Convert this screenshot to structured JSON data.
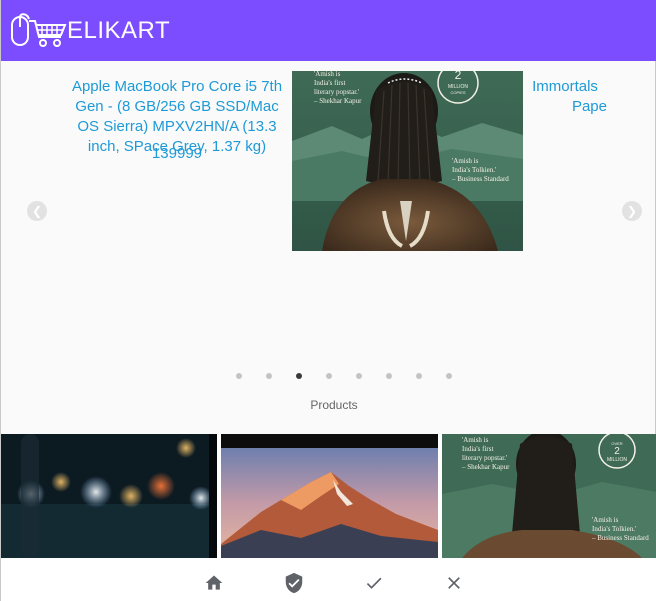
{
  "app": {
    "brand": "ELIKART",
    "accent": "#7c4dff",
    "link_color": "#1e9ad6"
  },
  "carousel": {
    "current_item": {
      "title": "Apple MacBook Pro Core i5 7th Gen - (8 GB/256 GB SSD/Mac OS Sierra) MPXV2HN/A  (13.3 inch, SPace Grey, 1.37 kg)",
      "price": "139999"
    },
    "next_item": {
      "title_line1": "Immortals",
      "title_line2": "Pape"
    },
    "book_cover": {
      "quote_top": "'Amish is India's first literary popstar.' – Shekhar Kapur",
      "badge_lines": [
        "OVER",
        "2",
        "MILLION",
        "COPIES",
        "SOLD"
      ],
      "quote_bottom": "'Amish is India's Tolkien.' – Business Standard"
    },
    "dots_total": 8,
    "active_dot": 3
  },
  "products": {
    "label": "Products"
  },
  "nav": {
    "icons": [
      "home-icon",
      "shield-check-icon",
      "check-icon",
      "close-icon"
    ]
  }
}
